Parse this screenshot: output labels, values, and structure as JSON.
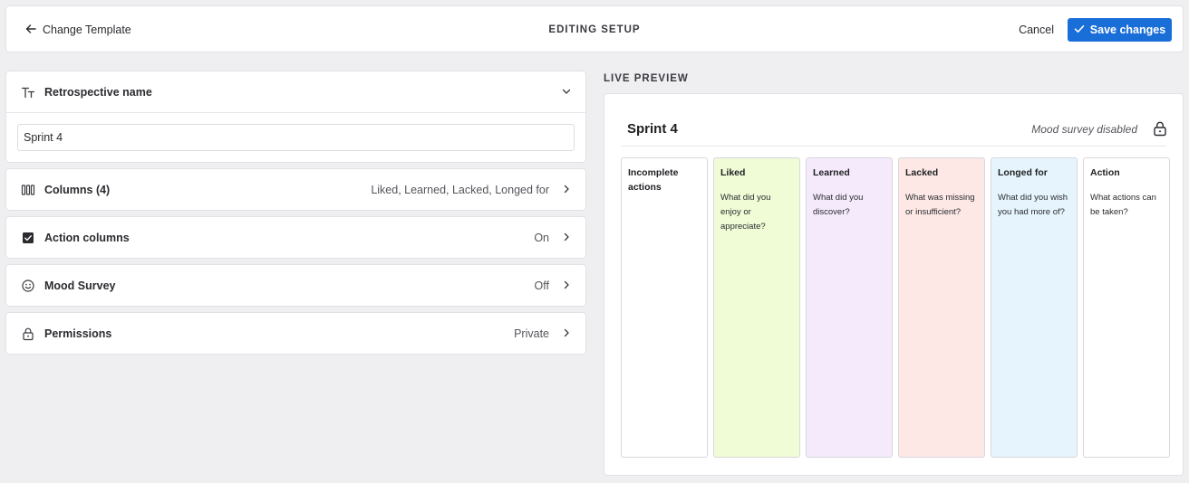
{
  "header": {
    "back_label": "Change Template",
    "title": "EDITING SETUP",
    "cancel_label": "Cancel",
    "save_label": "Save changes",
    "accent_color": "#1a6ed8"
  },
  "settings": {
    "name": {
      "label": "Retrospective name",
      "icon": "text-size-icon",
      "value": "Sprint 4"
    },
    "rows": [
      {
        "label": "Columns (4)",
        "value": "Liked, Learned, Lacked, Longed for",
        "icon": "columns-icon"
      },
      {
        "label": "Action columns",
        "value": "On",
        "icon": "checkbox-icon"
      },
      {
        "label": "Mood Survey",
        "value": "Off",
        "icon": "smiley-icon"
      },
      {
        "label": "Permissions",
        "value": "Private",
        "icon": "lock-icon"
      }
    ]
  },
  "preview": {
    "section_label": "LIVE PREVIEW",
    "title": "Sprint 4",
    "mood_status": "Mood survey disabled",
    "columns": [
      {
        "title": "Incomplete actions",
        "description": "",
        "color": "#ffffff"
      },
      {
        "title": "Liked",
        "description": "What did you enjoy or appreciate?",
        "color": "#effcd6"
      },
      {
        "title": "Learned",
        "description": "What did you discover?",
        "color": "#f5eafc"
      },
      {
        "title": "Lacked",
        "description": "What was missing or insufficient?",
        "color": "#fde8e6"
      },
      {
        "title": "Longed for",
        "description": "What did you wish you had more of?",
        "color": "#e6f5fd"
      },
      {
        "title": "Action",
        "description": "What actions can be taken?",
        "color": "#ffffff"
      }
    ]
  }
}
